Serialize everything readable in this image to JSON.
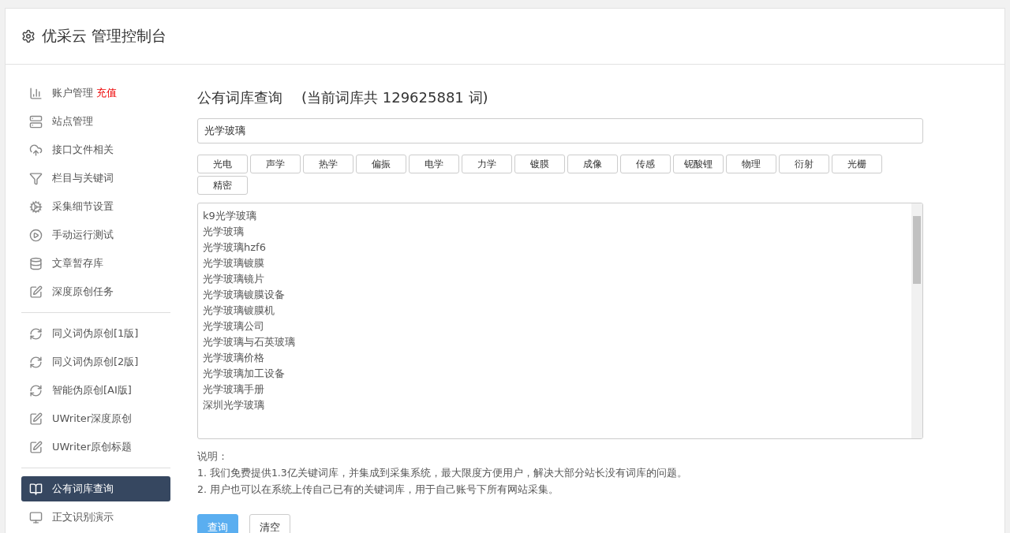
{
  "header": {
    "title": "优采云 管理控制台"
  },
  "sidebar": {
    "groups": [
      {
        "items": [
          {
            "kind": "chart",
            "label": "账户管理",
            "badge": "充值",
            "selected": false
          },
          {
            "kind": "server",
            "label": "站点管理",
            "selected": false
          },
          {
            "kind": "cloud",
            "label": "接口文件相关",
            "selected": false
          },
          {
            "kind": "filter",
            "label": "栏目与关键词",
            "selected": false
          },
          {
            "kind": "gears",
            "label": "采集细节设置",
            "selected": false
          },
          {
            "kind": "play",
            "label": "手动运行测试",
            "selected": false
          },
          {
            "kind": "database",
            "label": "文章暂存库",
            "selected": false
          },
          {
            "kind": "edit",
            "label": "深度原创任务",
            "selected": false
          }
        ]
      },
      {
        "items": [
          {
            "kind": "refresh",
            "label": "同义词伪原创[1版]",
            "selected": false
          },
          {
            "kind": "refresh",
            "label": "同义词伪原创[2版]",
            "selected": false
          },
          {
            "kind": "refresh",
            "label": "智能伪原创[AI版]",
            "selected": false
          },
          {
            "kind": "edit",
            "label": "UWriter深度原创",
            "selected": false
          },
          {
            "kind": "edit",
            "label": "UWriter原创标题",
            "selected": false
          }
        ]
      },
      {
        "items": [
          {
            "kind": "book",
            "label": "公有词库查询",
            "selected": true
          },
          {
            "kind": "monitor",
            "label": "正文识别演示",
            "selected": false
          }
        ]
      }
    ]
  },
  "main": {
    "title": "公有词库查询",
    "count_note": "(当前词库共 129625881 词)",
    "search": {
      "value": "光学玻璃"
    },
    "tags": [
      "光电",
      "声学",
      "热学",
      "偏振",
      "电学",
      "力学",
      "镀膜",
      "成像",
      "传感",
      "铌酸锂",
      "物理",
      "衍射",
      "光栅",
      "精密"
    ],
    "results": [
      "k9光学玻璃",
      "光学玻璃",
      "光学玻璃hzf6",
      "光学玻璃镀膜",
      "光学玻璃镜片",
      "光学玻璃镀膜设备",
      "光学玻璃镀膜机",
      "光学玻璃公司",
      "光学玻璃与石英玻璃",
      "光学玻璃价格",
      "光学玻璃加工设备",
      "光学玻璃手册",
      "深圳光学玻璃"
    ],
    "notes_title": "说明：",
    "notes": [
      "1. 我们免费提供1.3亿关键词库，并集成到采集系统，最大限度方便用户，解决大部分站长没有词库的问题。",
      "2. 用户也可以在系统上传自己已有的关键词库，用于自己账号下所有网站采集。"
    ],
    "buttons": [
      {
        "label": "查询",
        "kind": "primary"
      },
      {
        "label": "清空",
        "kind": "default"
      }
    ]
  }
}
